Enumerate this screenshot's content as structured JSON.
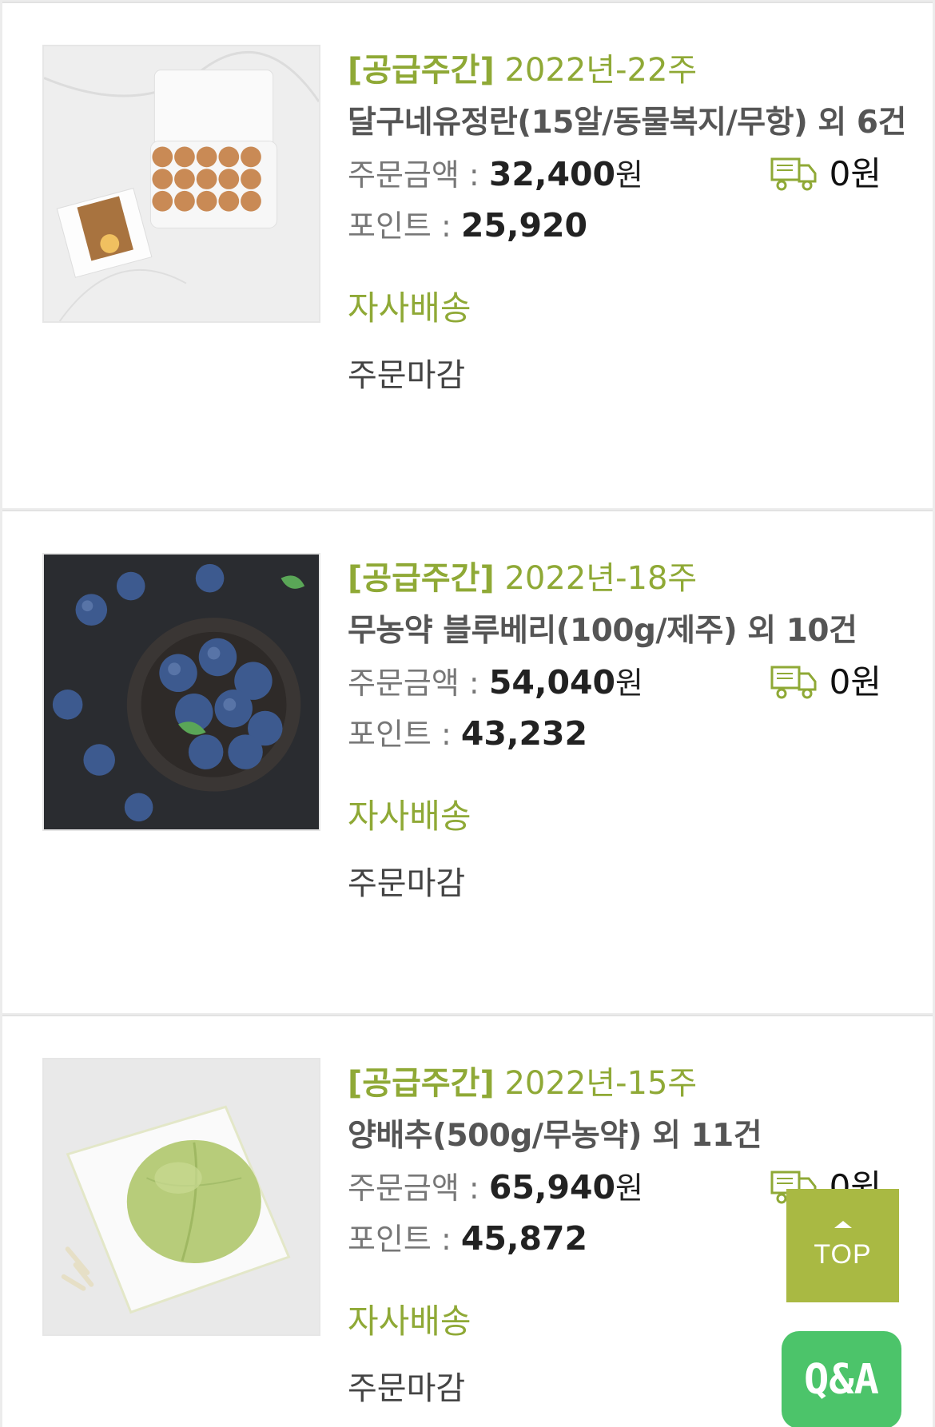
{
  "colors": {
    "accent": "#8fa936",
    "top_button": "#a9b943",
    "qa_button": "#4cc46a"
  },
  "orders": [
    {
      "week_tag": "[공급주간]",
      "week": "2022년-22주",
      "name": "달구네유정란(15알/동물복지/무항) 외 6건",
      "amount_label": "주문금액 : ",
      "amount": "32,400",
      "amount_unit": "원",
      "points_label": "포인트 : ",
      "points": "25,920",
      "shipping_fee": "0원",
      "delivery_type": "자사배송",
      "status": "주문마감",
      "image_icon": "eggs-photo"
    },
    {
      "week_tag": "[공급주간]",
      "week": "2022년-18주",
      "name": "무농약 블루베리(100g/제주) 외 10건",
      "amount_label": "주문금액 : ",
      "amount": "54,040",
      "amount_unit": "원",
      "points_label": "포인트 : ",
      "points": "43,232",
      "shipping_fee": "0원",
      "delivery_type": "자사배송",
      "status": "주문마감",
      "image_icon": "blueberries-photo"
    },
    {
      "week_tag": "[공급주간]",
      "week": "2022년-15주",
      "name": "양배추(500g/무농약) 외 11건",
      "amount_label": "주문금액 : ",
      "amount": "65,940",
      "amount_unit": "원",
      "points_label": "포인트 : ",
      "points": "45,872",
      "shipping_fee": "0원",
      "delivery_type": "자사배송",
      "status": "주문마감",
      "image_icon": "cabbage-photo"
    }
  ],
  "floating": {
    "top_label": "TOP",
    "qa_label": "Q&A"
  }
}
